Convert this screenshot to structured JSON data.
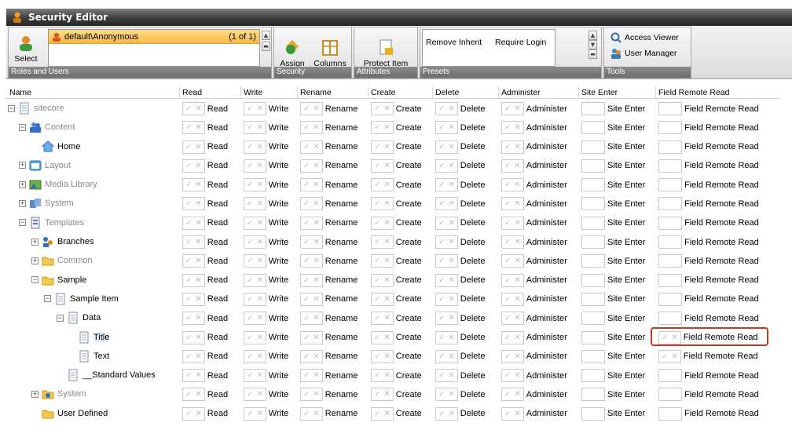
{
  "window": {
    "title": "Security Editor"
  },
  "ribbon": {
    "select_label": "Select",
    "user": "default\\Anonymous",
    "user_count": "(1 of 1)",
    "roles_caption": "Roles and Users",
    "assign_label": "Assign",
    "columns_label": "Columns",
    "security_caption": "Security",
    "protect_label": "Protect Item",
    "attributes_caption": "Attributes",
    "presets": [
      "Remove Inherit",
      "Require Login"
    ],
    "presets_caption": "Presets",
    "access_viewer": "Access Viewer",
    "user_manager": "User Manager",
    "tools_caption": "Tools"
  },
  "grid": {
    "columns": [
      "Name",
      "Read",
      "Write",
      "Rename",
      "Create",
      "Delete",
      "Administer",
      "Site Enter",
      "Field Remote Read"
    ],
    "cell_labels": {
      "read": "Read",
      "write": "Write",
      "rename": "Rename",
      "create": "Create",
      "delete": "Delete",
      "administer": "Administer",
      "site_enter": "Site Enter",
      "field_remote_read": "Field Remote Read"
    },
    "allow_glyph": "✓",
    "deny_glyph": "✕",
    "rows": [
      {
        "name": "sitecore",
        "expander": "−",
        "icon": "page-icon",
        "dim": true,
        "fr": false
      },
      {
        "name": "Content",
        "expander": "−",
        "icon": "content-icon",
        "dim": true,
        "fr": false
      },
      {
        "name": "Home",
        "expander": "",
        "icon": "home-icon",
        "dim": false,
        "fr": false
      },
      {
        "name": "Layout",
        "expander": "+",
        "icon": "layout-icon",
        "dim": true,
        "fr": false
      },
      {
        "name": "Media Library",
        "expander": "+",
        "icon": "media-icon",
        "dim": true,
        "fr": false
      },
      {
        "name": "System",
        "expander": "+",
        "icon": "system-icon",
        "dim": true,
        "fr": false
      },
      {
        "name": "Templates",
        "expander": "−",
        "icon": "templates-icon",
        "dim": true,
        "fr": false
      },
      {
        "name": "Branches",
        "expander": "+",
        "icon": "branches-icon",
        "dim": false,
        "fr": false
      },
      {
        "name": "Common",
        "expander": "+",
        "icon": "folder-icon",
        "dim": true,
        "fr": false
      },
      {
        "name": "Sample",
        "expander": "−",
        "icon": "folder-icon",
        "dim": false,
        "fr": false
      },
      {
        "name": "Sample Item",
        "expander": "−",
        "icon": "page-icon",
        "dim": false,
        "fr": false
      },
      {
        "name": "Data",
        "expander": "−",
        "icon": "page-icon",
        "dim": false,
        "fr": false
      },
      {
        "name": "Title",
        "expander": "",
        "icon": "page-icon",
        "dim": false,
        "fr": true,
        "selected": true
      },
      {
        "name": "Text",
        "expander": "",
        "icon": "page-icon",
        "dim": false,
        "fr": true
      },
      {
        "name": "__Standard Values",
        "expander": "",
        "icon": "page-icon",
        "dim": false,
        "fr": false
      },
      {
        "name": "System",
        "expander": "+",
        "icon": "system-folder-icon",
        "dim": true,
        "fr": false
      },
      {
        "name": "User Defined",
        "expander": "",
        "icon": "folder-icon",
        "dim": false,
        "fr": false
      }
    ]
  },
  "colors": {
    "highlight": "#d9301c",
    "selected_user": "#f8b948"
  }
}
